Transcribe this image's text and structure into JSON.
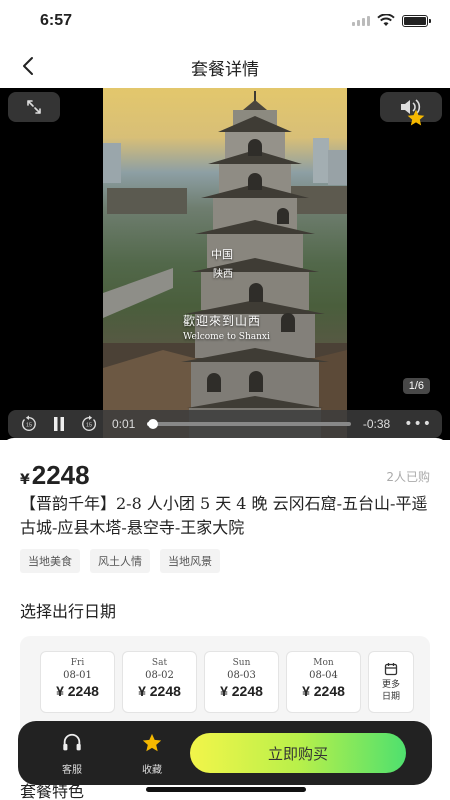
{
  "status_bar": {
    "time": "6:57"
  },
  "nav": {
    "title": "套餐详情"
  },
  "media": {
    "captions": {
      "line1": "中国",
      "line2": "陕西",
      "welcome": "歡迎來到山西",
      "welcome_en": "Welcome to Shanxi"
    },
    "page_counter": "1/6",
    "video": {
      "current_time": "0:01",
      "remaining_time": "-0:38",
      "progress": 0.03,
      "skip_seconds": "15"
    }
  },
  "package": {
    "currency": "¥",
    "price": "2248",
    "sold": "2人已购",
    "title": "【晋韵千年】2-8 人小团 5 天 4 晚 云冈石窟-五台山-平遥古城-应县木塔-悬空寺-王家大院",
    "tags": [
      "当地美食",
      "风土人情",
      "当地风景"
    ]
  },
  "date_section": {
    "heading": "选择出行日期",
    "dates": [
      {
        "day": "Fri",
        "date": "08-01",
        "price": "¥ 2248"
      },
      {
        "day": "Sat",
        "date": "08-02",
        "price": "¥ 2248"
      },
      {
        "day": "Sun",
        "date": "08-03",
        "price": "¥ 2248"
      },
      {
        "day": "Mon",
        "date": "08-04",
        "price": "¥ 2248"
      }
    ],
    "more_line1": "更多",
    "more_line2": "日期"
  },
  "features_section": {
    "heading": "套餐特色"
  },
  "action_bar": {
    "service_label": "客服",
    "favorite_label": "收藏",
    "buy_label": "立即购买",
    "accent_color": "#f5b800"
  }
}
